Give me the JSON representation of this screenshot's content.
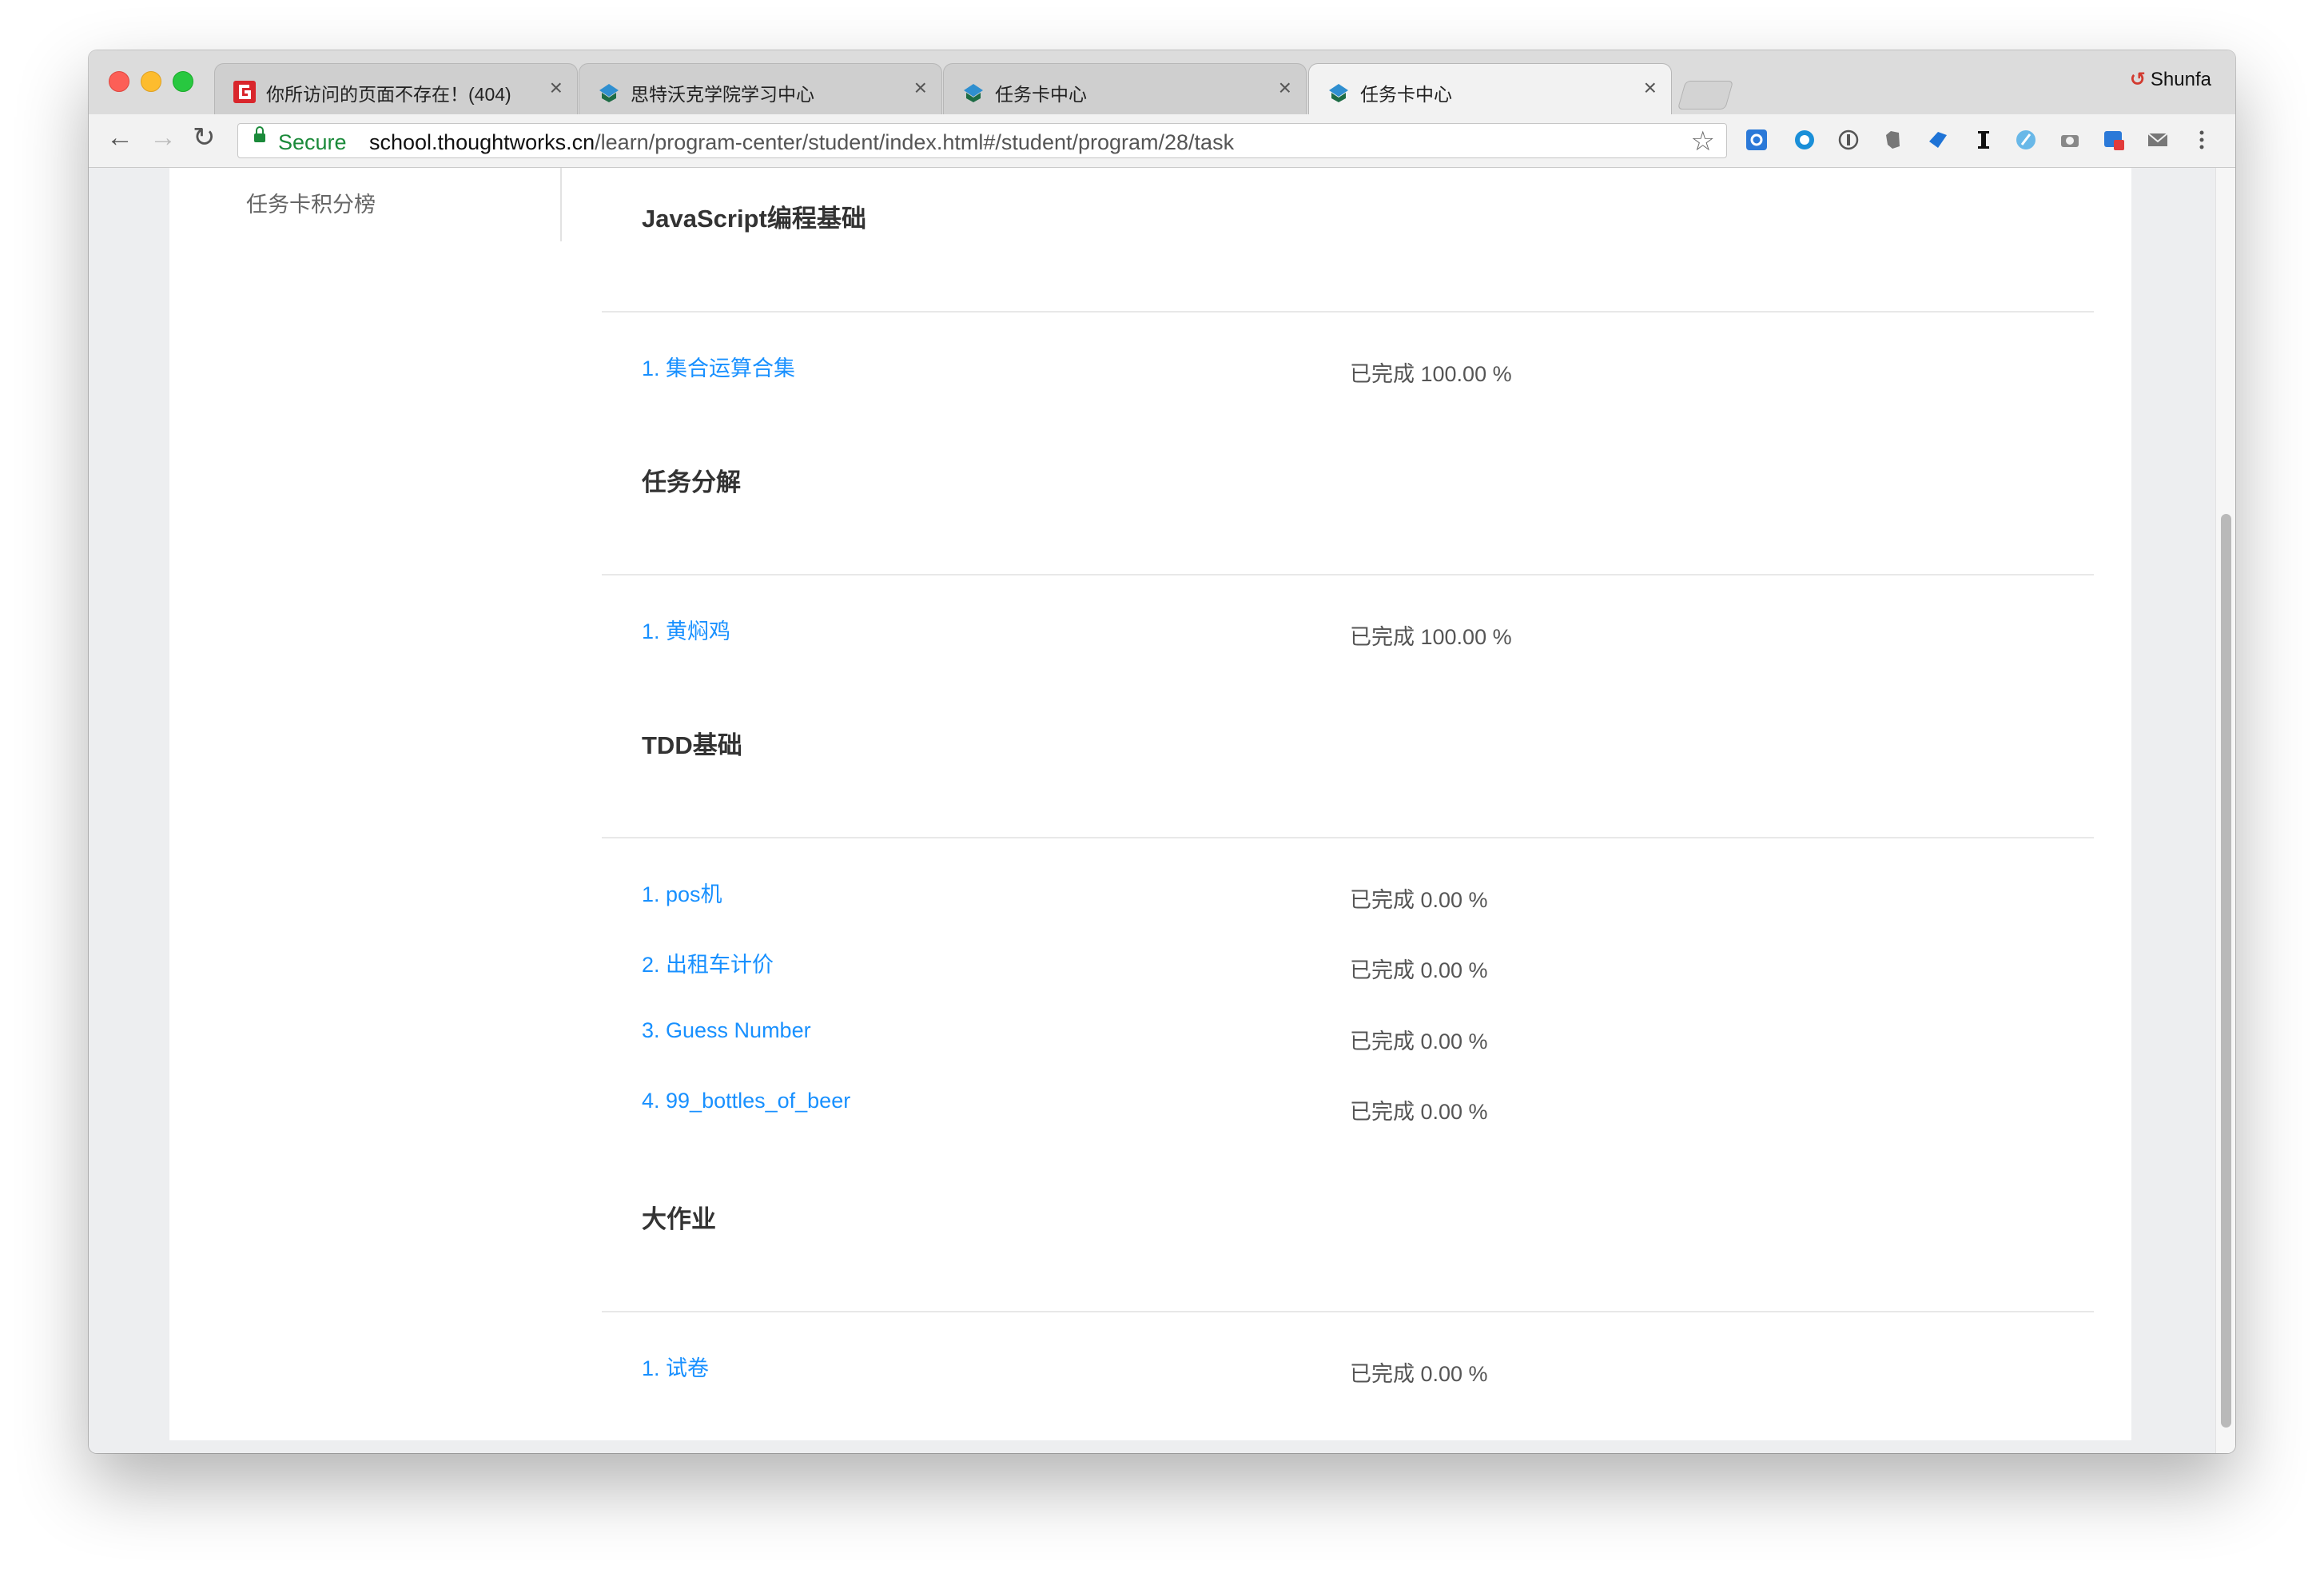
{
  "browser": {
    "tabs": [
      {
        "title": "你所访问的页面不存在！(404)",
        "icon": "red-g-favicon",
        "active": false
      },
      {
        "title": "思特沃克学院学习中心",
        "icon": "thoughtworks-favicon",
        "active": false
      },
      {
        "title": "任务卡中心",
        "icon": "thoughtworks-favicon",
        "active": false
      },
      {
        "title": "任务卡中心",
        "icon": "thoughtworks-favicon",
        "active": true
      }
    ],
    "close_glyph": "×",
    "profile_name": "Shunfa",
    "profile_icon": "↺",
    "secure_label": "Secure",
    "url_host": "school.thoughtworks.cn",
    "url_path": "/learn/program-center/student/index.html#/student/program/28/task",
    "nav": {
      "back": "←",
      "forward": "→",
      "reload": "↻",
      "bookmark": "☆"
    },
    "colors": {
      "secure": "#1b8a3a",
      "link": "#1890ff"
    }
  },
  "sidebar": {
    "leaderboard_label": "任务卡积分榜"
  },
  "sections": [
    {
      "title": "JavaScript编程基础",
      "tasks": [
        {
          "label": "1. 集合运算合集",
          "status": "已完成 100.00 %"
        }
      ]
    },
    {
      "title": "任务分解",
      "tasks": [
        {
          "label": "1. 黄焖鸡",
          "status": "已完成 100.00 %"
        }
      ]
    },
    {
      "title": "TDD基础",
      "tasks": [
        {
          "label": "1. pos机",
          "status": "已完成 0.00 %"
        },
        {
          "label": "2. 出租车计价",
          "status": "已完成 0.00 %"
        },
        {
          "label": "3. Guess Number",
          "status": "已完成 0.00 %"
        },
        {
          "label": "4. 99_bottles_of_beer",
          "status": "已完成 0.00 %"
        }
      ]
    },
    {
      "title": "大作业",
      "tasks": [
        {
          "label": "1. 试卷",
          "status": "已完成 0.00 %"
        }
      ]
    }
  ]
}
